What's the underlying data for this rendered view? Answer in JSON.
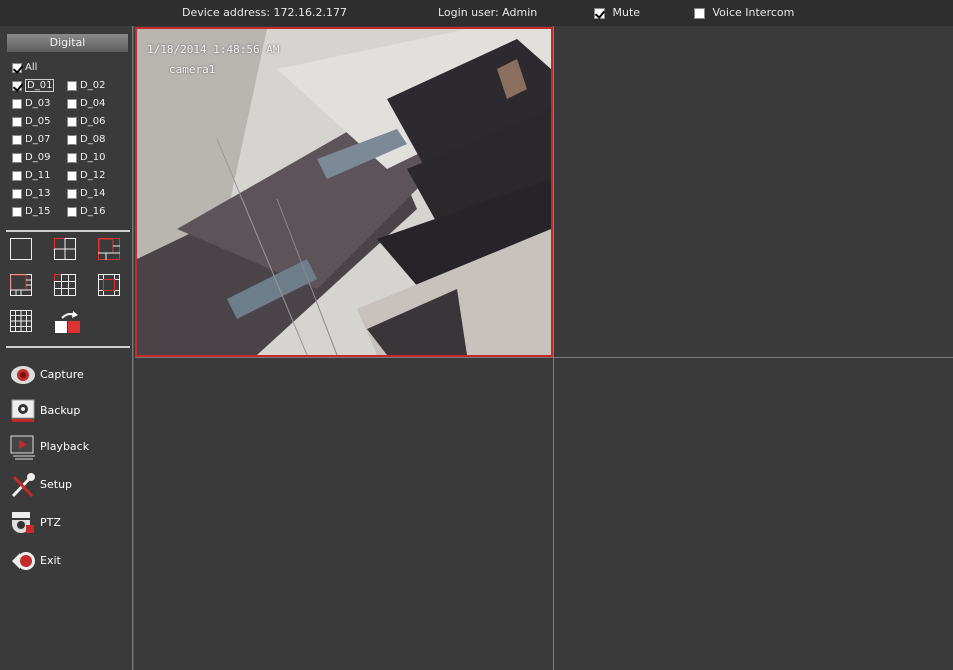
{
  "topbar": {
    "device_address": "Device address: 172.16.2.177",
    "login_user": "Login user: Admin",
    "mute_label": "Mute",
    "mute_checked": true,
    "voice_intercom_label": "Voice Intercom",
    "voice_intercom_checked": false
  },
  "sidebar": {
    "tab_label": "Digital",
    "all_label": "All",
    "channels": [
      "D_01",
      "D_02",
      "D_03",
      "D_04",
      "D_05",
      "D_06",
      "D_07",
      "D_08",
      "D_09",
      "D_10",
      "D_11",
      "D_12",
      "D_13",
      "D_14",
      "D_15",
      "D_16"
    ],
    "checked_channels": [
      "D_01"
    ],
    "layouts": [
      "1-split-icon",
      "4-split-icon",
      "6-split-icon",
      "8-split-icon",
      "9-split-icon",
      "13-split-icon",
      "16-split-icon",
      "sequence-switch-icon"
    ],
    "menu": [
      {
        "label": "Capture",
        "icon": "camera-capture-icon"
      },
      {
        "label": "Backup",
        "icon": "backup-icon"
      },
      {
        "label": "Playback",
        "icon": "playback-icon"
      },
      {
        "label": "Setup",
        "icon": "wrench-icon"
      },
      {
        "label": "PTZ",
        "icon": "ptz-dome-icon"
      },
      {
        "label": "Exit",
        "icon": "exit-icon"
      }
    ]
  },
  "video": {
    "pane1_timestamp": "1/18/2014 1:48:56 AM",
    "pane1_camera": "camera1"
  },
  "colors": {
    "accent_red": "#c42a2a",
    "background": "#3a3a3a"
  }
}
